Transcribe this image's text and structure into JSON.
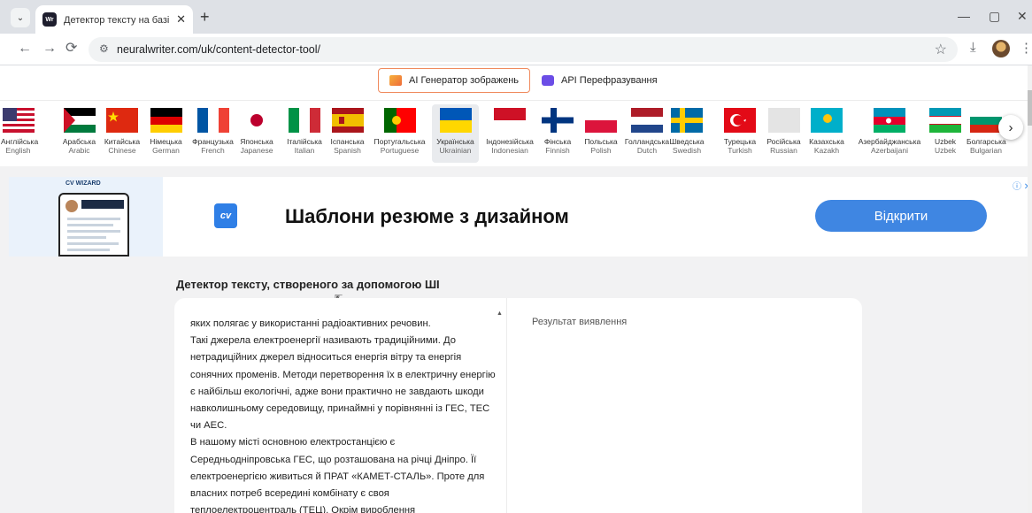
{
  "browser": {
    "tab_title": "Детектор тексту на базі ШІ ▶",
    "tab_favicon": "Wr",
    "tab_menu_icon": "⌄",
    "tab_close": "✕",
    "new_tab": "+",
    "minimize": "—",
    "restore": "▢",
    "close": "✕",
    "back": "←",
    "forward": "→",
    "reload": "⟳",
    "site_info_icon": "⚙",
    "url": "neuralwriter.com/uk/content-detector-tool/",
    "bookmark_star": "☆",
    "download": "⤓",
    "menu_dots": "⋮"
  },
  "topbar": {
    "image_generator_label": "AI Генератор зображень",
    "paraphrase_api_label": "API Перефразування"
  },
  "languages": [
    {
      "name": "Англійська",
      "en": "English"
    },
    {
      "name": "Арабська",
      "en": "Arabic"
    },
    {
      "name": "Китайська",
      "en": "Chinese"
    },
    {
      "name": "Німецька",
      "en": "German"
    },
    {
      "name": "Французька",
      "en": "French"
    },
    {
      "name": "Японська",
      "en": "Japanese"
    },
    {
      "name": "Італійська",
      "en": "Italian"
    },
    {
      "name": "Іспанська",
      "en": "Spanish"
    },
    {
      "name": "Португальська",
      "en": "Portuguese"
    },
    {
      "name": "Українська",
      "en": "Ukrainian",
      "active": true
    },
    {
      "name": "Індонезійська",
      "en": "Indonesian"
    },
    {
      "name": "Фінська",
      "en": "Finnish"
    },
    {
      "name": "Польська",
      "en": "Polish"
    },
    {
      "name": "Голландська",
      "en": "Dutch"
    },
    {
      "name": "Шведська",
      "en": "Swedish"
    },
    {
      "name": "Турецька",
      "en": "Turkish"
    },
    {
      "name": "Російська",
      "en": "Russian"
    },
    {
      "name": "Казахська",
      "en": "Kazakh"
    },
    {
      "name": "Азербайджанська",
      "en": "Azerbaijani"
    },
    {
      "name": "Uzbek",
      "en": "Uzbek"
    },
    {
      "name": "Болгарська",
      "en": "Bulgarian"
    }
  ],
  "language_next": "›",
  "ad": {
    "logo": "CV WIZARD",
    "badge": "cv",
    "headline": "Шаблони резюме з дизайном",
    "cta": "Відкрити",
    "choices": "ⓘ ✕"
  },
  "tool": {
    "title": "Детектор тексту, створеного за допомогою ШІ",
    "input_text": "яких полягає у використанні радіоактивних речовин.\nТакі джерела електроенергії називають традиційними. До нетрадиційних джерел відноситься енергія вітру та енергія сонячних променів. Методи перетворення їх в електричну енергію є найбільш екологічні, адже вони практично не завдають шкоди навколишньому середовищу, принаймні у порівнянні із ГЕС, ТЕС чи АЕС.\nВ нашому місті основною електростанцією є Середньодніпровська ГЕС, що розташована на річці Дніпро. Її електроенергією живиться й ПРАТ «КАМЕТ-СТАЛЬ». Проте для власних потреб всередині комбінату є своя теплоелектроцентраль (ТЕЦ). Окрім вироблення",
    "result_label": "Результат виявлення",
    "scroll_up": "▲"
  },
  "colors": {
    "accent_orange": "#f08a5d",
    "cta_blue": "#3f86e2",
    "api_purple": "#6b4de6"
  }
}
